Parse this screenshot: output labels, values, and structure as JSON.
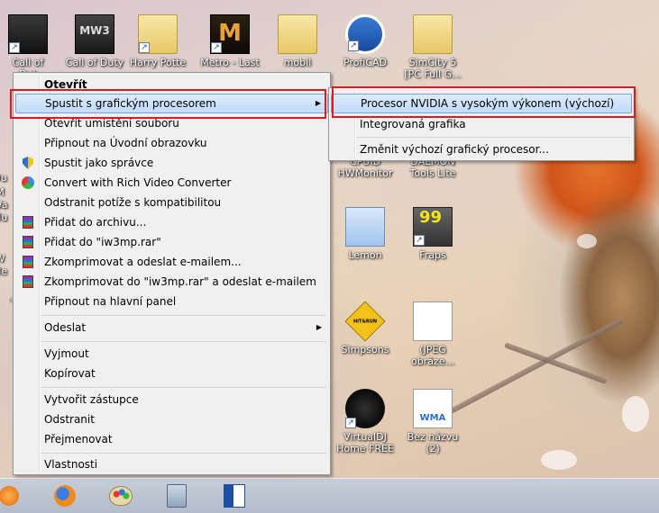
{
  "desktop": {
    "icons": [
      {
        "id": "callof",
        "label": "Call of\nDut"
      },
      {
        "id": "cod-mw3",
        "label": "Call of Duty"
      },
      {
        "id": "harry",
        "label": "Harry Potte"
      },
      {
        "id": "metro",
        "label": "Metro - Last"
      },
      {
        "id": "mobil",
        "label": "mobil"
      },
      {
        "id": "proficad",
        "label": "ProfiCAD"
      },
      {
        "id": "simcity",
        "label": "SimCity 5\n[PC Full G..."
      },
      {
        "id": "cpuid",
        "label": "CPUID\nHWMonitor"
      },
      {
        "id": "daemon",
        "label": "DAEMON\nTools Lite"
      },
      {
        "id": "lemon",
        "label": "Lemon"
      },
      {
        "id": "fraps",
        "label": "Fraps"
      },
      {
        "id": "simpsons",
        "label": "Simpsons"
      },
      {
        "id": "jpeg",
        "label": "(JPEG\nobráze..."
      },
      {
        "id": "virtualdj",
        "label": "VirtualDJ\nHome FREE"
      },
      {
        "id": "beznazvu",
        "label": "Bez názvu (2)"
      }
    ],
    "left_partial_labels": [
      "Du",
      "M",
      "Wa",
      "Mu",
      "W",
      "Me"
    ],
    "icon_glyphs": {
      "mw3": "MW3",
      "metro": "M",
      "fraps": "99",
      "wma": "WMA",
      "simpsons": "HIT&RUN"
    }
  },
  "context_menu": {
    "items": [
      {
        "label": "Otevřít",
        "bold": true
      },
      {
        "label": "Spustit s grafickým procesorem",
        "submenu": true,
        "highlighted": true
      },
      {
        "label": "Otevřít umístění souboru"
      },
      {
        "label": "Připnout na Úvodní obrazovku"
      },
      {
        "label": "Spustit jako správce",
        "icon": "shield-icon"
      },
      {
        "label": "Convert with Rich Video Converter",
        "icon": "rich-video-converter-icon"
      },
      {
        "label": "Odstranit potíže s kompatibilitou"
      },
      {
        "label": "Přidat do archivu...",
        "icon": "winrar-icon"
      },
      {
        "label": "Přidat do \"iw3mp.rar\"",
        "icon": "winrar-icon"
      },
      {
        "label": "Zkomprimovat a odeslat e-mailem...",
        "icon": "winrar-icon"
      },
      {
        "label": "Zkomprimovat do \"iw3mp.rar\" a odeslat e-mailem",
        "icon": "winrar-icon"
      },
      {
        "label": "Připnout na hlavní panel"
      },
      {
        "label": "Odeslat",
        "submenu": true
      },
      {
        "label": "Vyjmout"
      },
      {
        "label": "Kopírovat"
      },
      {
        "label": "Vytvořit zástupce"
      },
      {
        "label": "Odstranit"
      },
      {
        "label": "Přejmenovat"
      },
      {
        "label": "Vlastnosti"
      }
    ]
  },
  "submenu": {
    "items": [
      {
        "label": "Procesor NVIDIA s vysokým výkonem (výchozí)",
        "highlighted": true
      },
      {
        "label": "Integrovaná grafika"
      },
      {
        "label": "Změnit výchozí grafický procesor..."
      }
    ]
  },
  "taskbar": {
    "buttons": [
      "media-player-icon",
      "firefox-icon",
      "paint-icon",
      "calculator-icon",
      "word-icon"
    ]
  },
  "colors": {
    "menu_bg": "#f0f0f0",
    "highlight": "#c1dcfc",
    "annotation_red": "#e0191f",
    "taskbar": "#b3bcca"
  }
}
